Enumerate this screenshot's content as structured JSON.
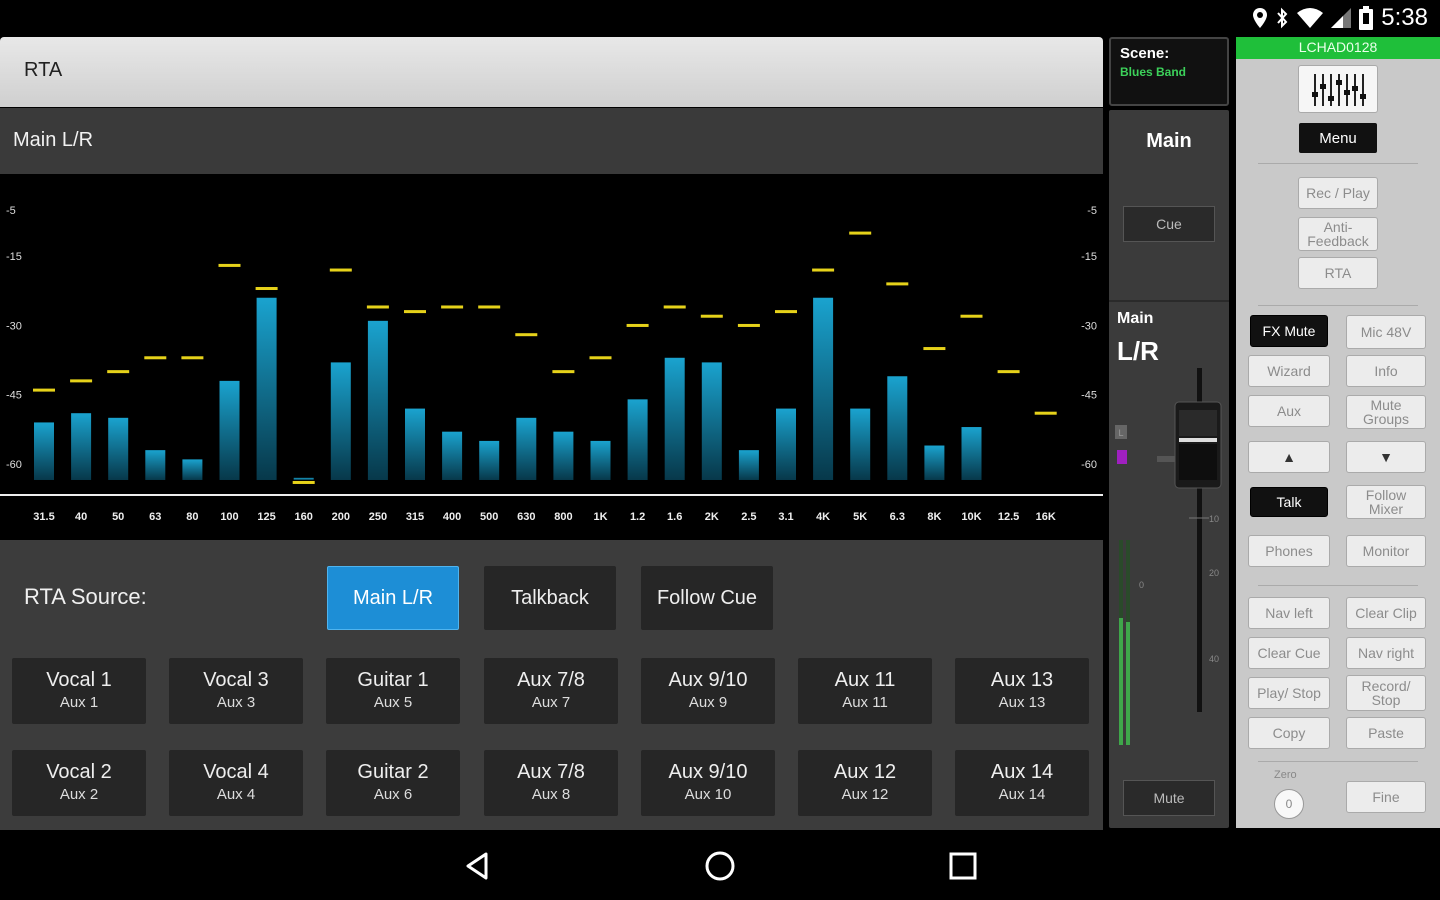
{
  "status_bar": {
    "time": "5:38"
  },
  "rta": {
    "title": "RTA",
    "source_title": "Main L/R"
  },
  "rta_graph": {
    "db_labels": [
      "-5",
      "-15",
      "-30",
      "-45",
      "-60"
    ],
    "bands": [
      "31.5",
      "40",
      "50",
      "63",
      "80",
      "100",
      "125",
      "160",
      "200",
      "250",
      "315",
      "400",
      "500",
      "630",
      "800",
      "1K",
      "1.2",
      "1.6",
      "2K",
      "2.5",
      "3.1",
      "4K",
      "5K",
      "6.3",
      "8K",
      "10K",
      "12.5",
      "16K"
    ],
    "levels": [
      -51,
      -49,
      -50,
      -57,
      -59,
      -42,
      -24,
      -63,
      -38,
      -29,
      -48,
      -53,
      -55,
      -50,
      -53,
      -55,
      -46,
      -37,
      -38,
      -57,
      -48,
      -24,
      -48,
      -41,
      -56,
      -52,
      -64,
      -99
    ],
    "peaks": [
      -44,
      -42,
      -40,
      -37,
      -37,
      -17,
      -22,
      -64,
      -18,
      -26,
      -27,
      -26,
      -26,
      -32,
      -40,
      -37,
      -30,
      -26,
      -28,
      -30,
      -27,
      -18,
      -10,
      -21,
      -35,
      -28,
      -40,
      -49
    ],
    "bar_color": "#1aa3cf",
    "peak_color": "#e6d21a"
  },
  "rta_source": {
    "label": "RTA Source:",
    "options": [
      "Main L/R",
      "Talkback",
      "Follow Cue"
    ],
    "selected": "Main L/R"
  },
  "mixes": [
    {
      "name": "Vocal 1",
      "sub": "Aux 1"
    },
    {
      "name": "Vocal 3",
      "sub": "Aux 3"
    },
    {
      "name": "Guitar 1",
      "sub": "Aux 5"
    },
    {
      "name": "Aux 7/8",
      "sub": "Aux 7"
    },
    {
      "name": "Aux 9/10",
      "sub": "Aux 9"
    },
    {
      "name": "Aux 11",
      "sub": "Aux 11"
    },
    {
      "name": "Aux 13",
      "sub": "Aux 13"
    },
    {
      "name": "Vocal 2",
      "sub": "Aux 2"
    },
    {
      "name": "Vocal 4",
      "sub": "Aux 4"
    },
    {
      "name": "Guitar 2",
      "sub": "Aux 6"
    },
    {
      "name": "Aux 7/8",
      "sub": "Aux 8"
    },
    {
      "name": "Aux 9/10",
      "sub": "Aux 10"
    },
    {
      "name": "Aux 12",
      "sub": "Aux 12"
    },
    {
      "name": "Aux 14",
      "sub": "Aux 14"
    }
  ],
  "scene": {
    "label": "Scene:",
    "name": "Blues Band"
  },
  "strip": {
    "title": "Main",
    "cue": "Cue",
    "name_line1": "Main",
    "name_line2": "L/R",
    "mute": "Mute",
    "scale": [
      "10",
      "20",
      "40"
    ],
    "meter_zero": "0"
  },
  "right_panel": {
    "device": "LCHAD0128",
    "menu": "Menu",
    "rec_play": "Rec / Play",
    "anti_feedback": "Anti-Feedback",
    "rta": "RTA",
    "fx_mute": "FX Mute",
    "mic_48v": "Mic 48V",
    "wizard": "Wizard",
    "info": "Info",
    "aux": "Aux",
    "mute_groups": "Mute Groups",
    "up": "▲",
    "down": "▼",
    "talk": "Talk",
    "follow_mixer": "Follow Mixer",
    "phones": "Phones",
    "monitor": "Monitor",
    "nav_left": "Nav left",
    "clear_clip": "Clear Clip",
    "clear_cue": "Clear Cue",
    "nav_right": "Nav right",
    "play_stop": "Play/ Stop",
    "record_stop": "Record/ Stop",
    "copy": "Copy",
    "paste": "Paste",
    "zero_label": "Zero",
    "zero_value": "0",
    "fine": "Fine"
  }
}
